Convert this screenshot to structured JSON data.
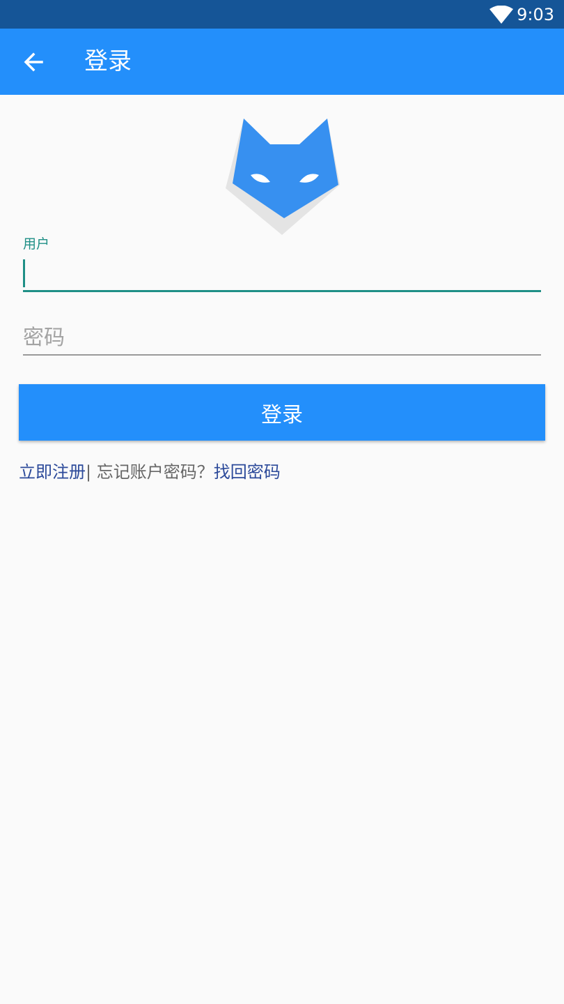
{
  "status_bar": {
    "time": "9:03",
    "wifi_icon": "wifi-icon"
  },
  "app_bar": {
    "title": "登录",
    "back_icon": "arrow-left-icon",
    "color": "#238ffb"
  },
  "logo": {
    "icon": "fox-logo-icon",
    "color": "#3790f0"
  },
  "form": {
    "user_label": "用户",
    "user_value": "",
    "password_placeholder": "密码",
    "login_label": "登录"
  },
  "links": {
    "register": "立即注册",
    "separator": "| 忘记账户密码？",
    "recover": "找回密码"
  },
  "colors": {
    "status_bar": "#155597",
    "focus": "#1f8f86",
    "link": "#2c4a9a",
    "background": "#fafafa"
  }
}
